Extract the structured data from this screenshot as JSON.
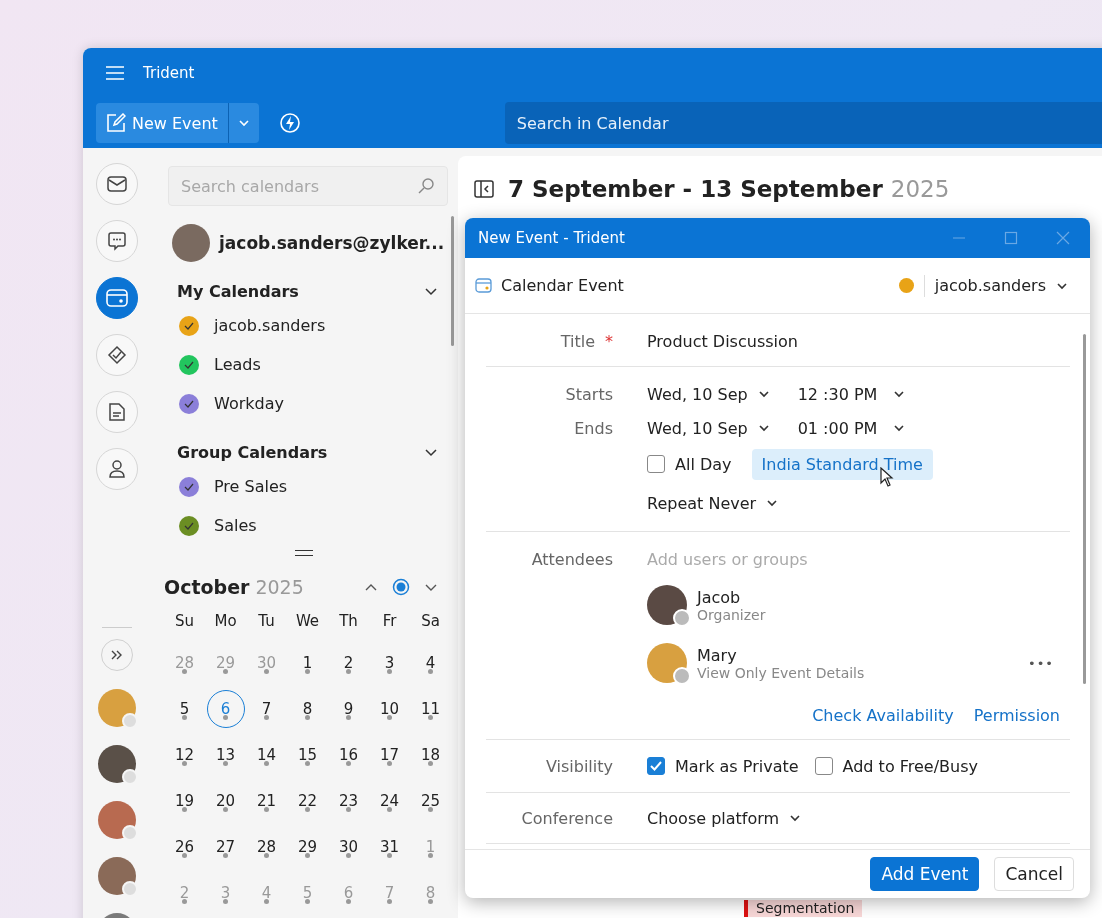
{
  "app": {
    "title": "Trident",
    "new_event": "New Event",
    "search_placeholder": "Search in Calendar"
  },
  "rail": {
    "items": [
      {
        "kind": "mail",
        "selected": false
      },
      {
        "kind": "chat",
        "selected": false
      },
      {
        "kind": "calendar",
        "selected": true
      },
      {
        "kind": "tasks",
        "selected": false
      },
      {
        "kind": "notes",
        "selected": false
      },
      {
        "kind": "contacts",
        "selected": false
      }
    ]
  },
  "sidebar": {
    "search_placeholder": "Search calendars",
    "account": "jacob.sanders@zylker...",
    "groups": [
      {
        "title": "My Calendars",
        "expanded": true,
        "calendars": [
          {
            "name": "jacob.sanders",
            "color": "#e8a317",
            "checked": true
          },
          {
            "name": "Leads",
            "color": "#22c55e",
            "checked": true
          },
          {
            "name": "Workday",
            "color": "#8b7fd9",
            "checked": true
          }
        ]
      },
      {
        "title": "Group Calendars",
        "expanded": true,
        "calendars": [
          {
            "name": "Pre Sales",
            "color": "#8b7fd9",
            "checked": true
          },
          {
            "name": "Sales",
            "color": "#6b8e23",
            "checked": true
          }
        ]
      }
    ]
  },
  "mini_calendar": {
    "month": "October",
    "year": "2025",
    "weekdays": [
      "Su",
      "Mo",
      "Tu",
      "We",
      "Th",
      "Fr",
      "Sa"
    ],
    "days": [
      {
        "day": "28",
        "outside": true,
        "today": false
      },
      {
        "day": "29",
        "outside": true,
        "today": false
      },
      {
        "day": "30",
        "outside": true,
        "today": false
      },
      {
        "day": "1",
        "outside": false,
        "today": false
      },
      {
        "day": "2",
        "outside": false,
        "today": false
      },
      {
        "day": "3",
        "outside": false,
        "today": false
      },
      {
        "day": "4",
        "outside": false,
        "today": false
      },
      {
        "day": "5",
        "outside": false,
        "today": false
      },
      {
        "day": "6",
        "outside": false,
        "today": true
      },
      {
        "day": "7",
        "outside": false,
        "today": false
      },
      {
        "day": "8",
        "outside": false,
        "today": false
      },
      {
        "day": "9",
        "outside": false,
        "today": false
      },
      {
        "day": "10",
        "outside": false,
        "today": false
      },
      {
        "day": "11",
        "outside": false,
        "today": false
      },
      {
        "day": "12",
        "outside": false,
        "today": false
      },
      {
        "day": "13",
        "outside": false,
        "today": false
      },
      {
        "day": "14",
        "outside": false,
        "today": false
      },
      {
        "day": "15",
        "outside": false,
        "today": false
      },
      {
        "day": "16",
        "outside": false,
        "today": false
      },
      {
        "day": "17",
        "outside": false,
        "today": false
      },
      {
        "day": "18",
        "outside": false,
        "today": false
      },
      {
        "day": "19",
        "outside": false,
        "today": false
      },
      {
        "day": "20",
        "outside": false,
        "today": false
      },
      {
        "day": "21",
        "outside": false,
        "today": false
      },
      {
        "day": "22",
        "outside": false,
        "today": false
      },
      {
        "day": "23",
        "outside": false,
        "today": false
      },
      {
        "day": "24",
        "outside": false,
        "today": false
      },
      {
        "day": "25",
        "outside": false,
        "today": false
      },
      {
        "day": "26",
        "outside": false,
        "today": false
      },
      {
        "day": "27",
        "outside": false,
        "today": false
      },
      {
        "day": "28",
        "outside": false,
        "today": false
      },
      {
        "day": "29",
        "outside": false,
        "today": false
      },
      {
        "day": "30",
        "outside": false,
        "today": false
      },
      {
        "day": "31",
        "outside": false,
        "today": false
      },
      {
        "day": "1",
        "outside": true,
        "today": false
      },
      {
        "day": "2",
        "outside": true,
        "today": false
      },
      {
        "day": "3",
        "outside": true,
        "today": false
      },
      {
        "day": "4",
        "outside": true,
        "today": false
      },
      {
        "day": "5",
        "outside": true,
        "today": false
      },
      {
        "day": "6",
        "outside": true,
        "today": false
      },
      {
        "day": "7",
        "outside": true,
        "today": false
      },
      {
        "day": "8",
        "outside": true,
        "today": false
      }
    ]
  },
  "main": {
    "title": "7 September - 13 September",
    "year": "2025",
    "background_event": "Segmentation"
  },
  "dialog": {
    "title": "New Event - Trident",
    "type": "Calendar Event",
    "calendar": {
      "name": "jacob.sanders",
      "color": "#e8a317"
    },
    "title_label": "Title",
    "required_mark": "*",
    "title_value": "Product Discussion",
    "starts_label": "Starts",
    "start_date": "Wed, 10 Sep",
    "start_time": "12 :30 PM",
    "ends_label": "Ends",
    "end_date": "Wed, 10 Sep",
    "end_time": "01 :00 PM",
    "all_day": {
      "label": "All Day",
      "checked": false
    },
    "timezone": "India Standard Time",
    "repeat": "Repeat Never",
    "attendees_label": "Attendees",
    "attendees_placeholder": "Add users or groups",
    "attendees": [
      {
        "name": "Jacob",
        "role": "Organizer",
        "more": false
      },
      {
        "name": "Mary",
        "role": "View Only Event Details",
        "more": true
      }
    ],
    "more_icon": "•••",
    "links": [
      "Check Availability",
      "Permission"
    ],
    "visibility_label": "Visibility",
    "visibility_options": [
      {
        "label": "Mark as Private",
        "checked": true
      },
      {
        "label": "Add to Free/Busy",
        "checked": false
      }
    ],
    "conference_label": "Conference",
    "conference": "Choose platform",
    "primary_button": "Add Event",
    "cancel_button": "Cancel"
  }
}
